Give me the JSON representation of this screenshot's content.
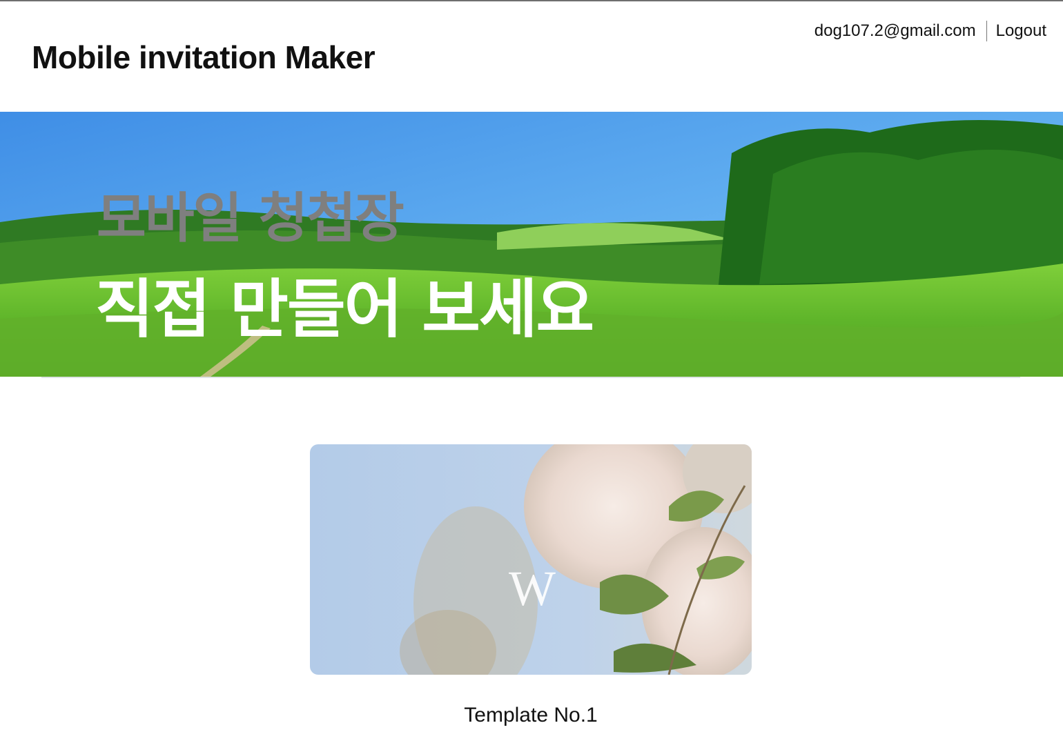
{
  "header": {
    "title": "Mobile invitation Maker",
    "user_email": "dog107.2@gmail.com",
    "logout_label": "Logout"
  },
  "hero": {
    "line1": "모바일 청첩장",
    "line2": "직접 만들어 보세요",
    "line1_color": "#7f7f7f",
    "line2_color": "#ffffff"
  },
  "templates": [
    {
      "label": "Template No.1",
      "monogram": "W"
    }
  ]
}
